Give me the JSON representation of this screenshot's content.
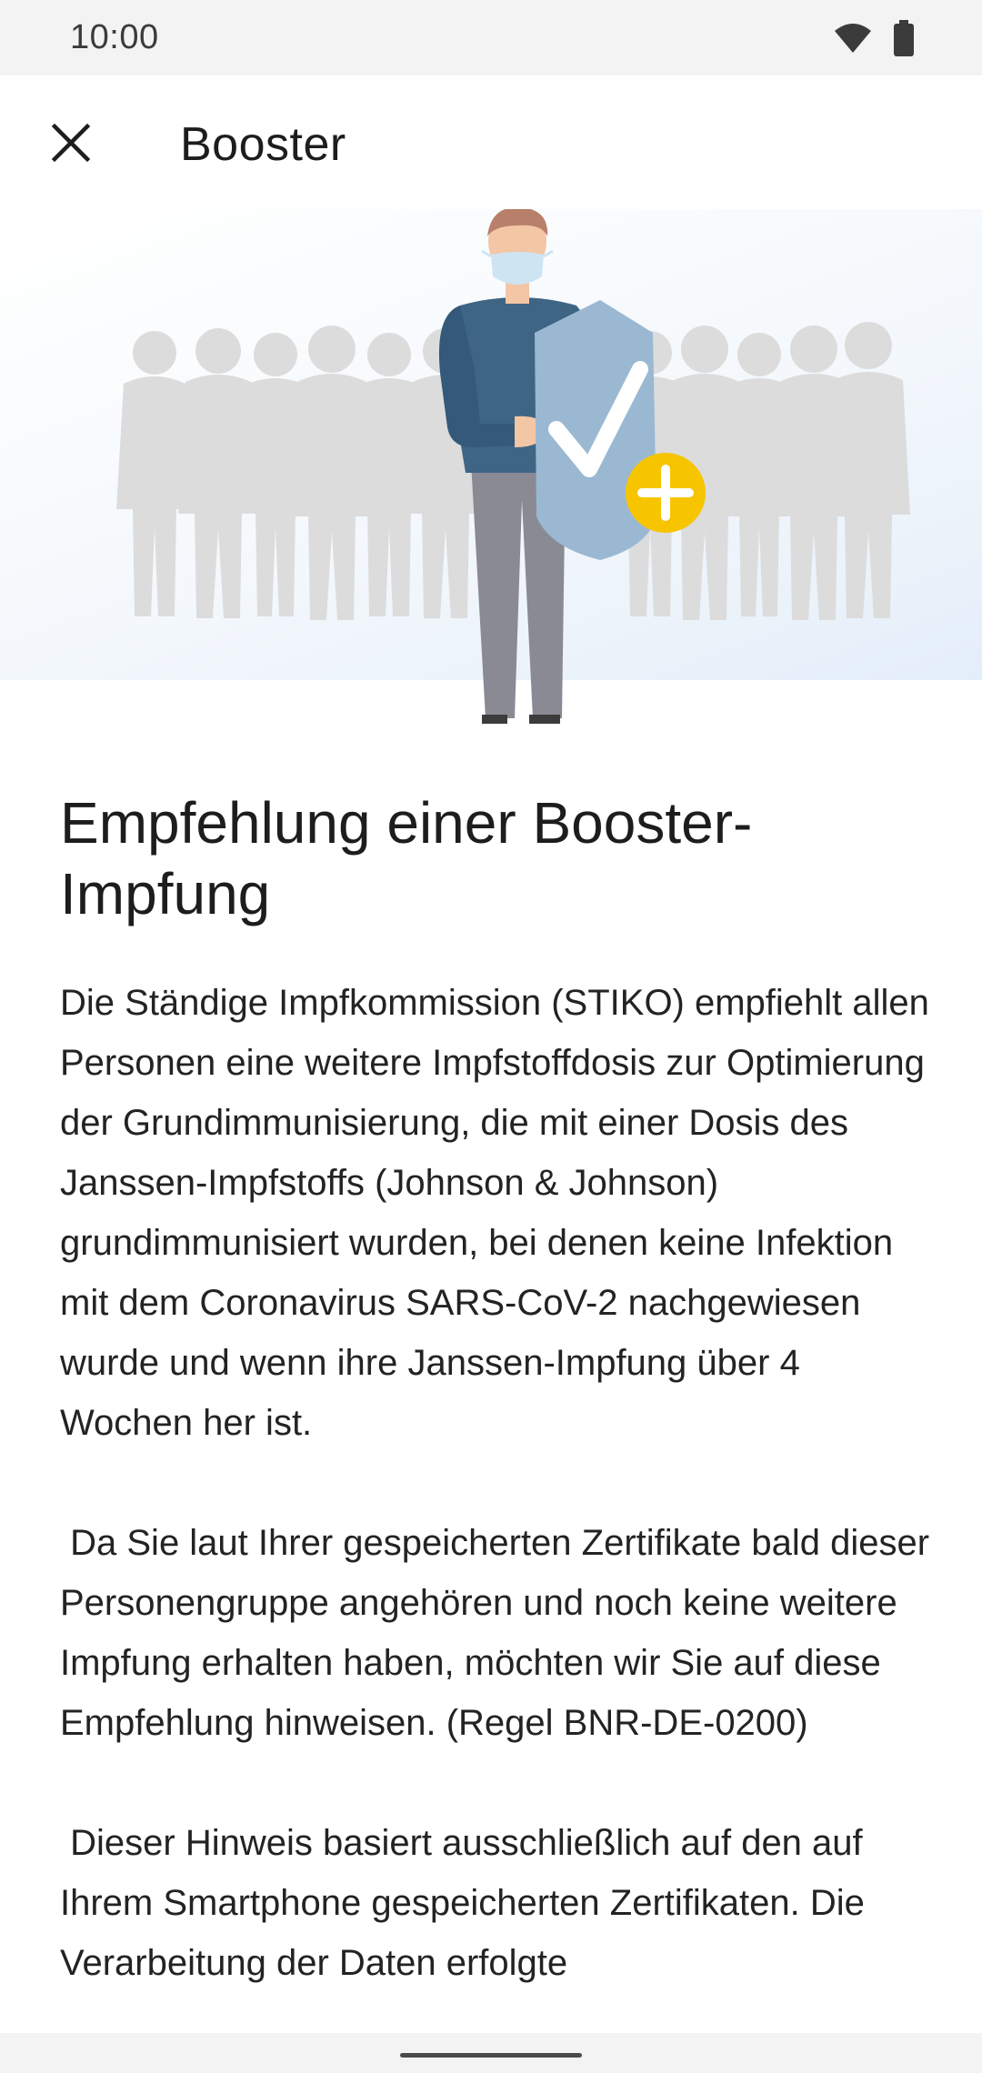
{
  "status_bar": {
    "time": "10:00",
    "icons": [
      "wifi-icon",
      "battery-icon"
    ]
  },
  "app_bar": {
    "close_icon": "close-icon",
    "title": "Booster"
  },
  "hero": {
    "illustration": "booster-illustration",
    "colors": {
      "crowd": "#dcdcdc",
      "shield": "#9ab8d2",
      "shirt": "#3f6585",
      "pants": "#8a8a95",
      "plus_badge": "#f7c400"
    }
  },
  "content": {
    "heading": "Empfehlung einer Booster-Impfung",
    "body": "Die Ständige Impfkommission (STIKO) empfiehlt allen Personen eine weitere Impfstoffdosis zur Optimierung der Grundimmunisierung, die mit einer Dosis des Janssen-Impfstoffs (Johnson & Johnson) grundimmunisiert wurden, bei denen keine Infektion mit dem Coronavirus SARS-CoV-2 nachgewiesen wurde und wenn ihre Janssen-Impfung über 4 Wochen her ist.\n\n Da Sie laut Ihrer gespeicherten Zertifikate bald dieser Personengruppe angehören und noch keine weitere Impfung erhalten haben, möchten wir Sie auf diese Empfehlung hinweisen. (Regel BNR-DE-0200)\n\n Dieser Hinweis basiert ausschließlich auf den auf Ihrem Smartphone gespeicherten Zertifikaten. Die Verarbeitung der Daten erfolgte"
  }
}
